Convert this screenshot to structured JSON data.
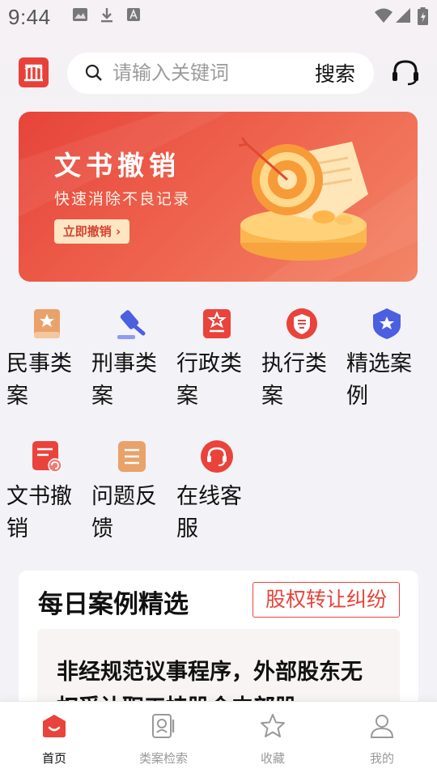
{
  "status_bar": {
    "time": "9:44"
  },
  "search": {
    "placeholder": "请输入关键词",
    "button_label": "搜索"
  },
  "banner": {
    "title": "文书撤销",
    "subtitle": "快速消除不良记录",
    "button_label": "立即撤销 ›"
  },
  "categories": [
    {
      "label": "民事类案",
      "icon": "civil-book-icon",
      "color": "#e9a26a"
    },
    {
      "label": "刑事类案",
      "icon": "gavel-icon",
      "color": "#4b5fe0"
    },
    {
      "label": "行政类案",
      "icon": "admin-badge-icon",
      "color": "#e9433b"
    },
    {
      "label": "执行类案",
      "icon": "law-shield-icon",
      "color": "#e9433b"
    },
    {
      "label": "精选案例",
      "icon": "star-shield-icon",
      "color": "#4b5fe0"
    },
    {
      "label": "文书撤销",
      "icon": "document-revoke-icon",
      "color": "#e9433b"
    },
    {
      "label": "问题反馈",
      "icon": "feedback-list-icon",
      "color": "#e9a26a"
    },
    {
      "label": "在线客服",
      "icon": "headset-icon",
      "color": "#e9433b"
    }
  ],
  "daily": {
    "title": "每日案例精选",
    "tag": "股权转让纠纷",
    "item_title": "非经规范议事程序，外部股东无权受让职工持股会内部股"
  },
  "bottom_nav": [
    {
      "label": "首页",
      "icon": "home-icon",
      "active": true
    },
    {
      "label": "类案检索",
      "icon": "case-search-icon",
      "active": false
    },
    {
      "label": "收藏",
      "icon": "star-icon",
      "active": false
    },
    {
      "label": "我的",
      "icon": "user-icon",
      "active": false
    }
  ],
  "colors": {
    "brand_red": "#e9433b",
    "accent_blue": "#4b5fe0",
    "accent_orange": "#e9a26a"
  }
}
